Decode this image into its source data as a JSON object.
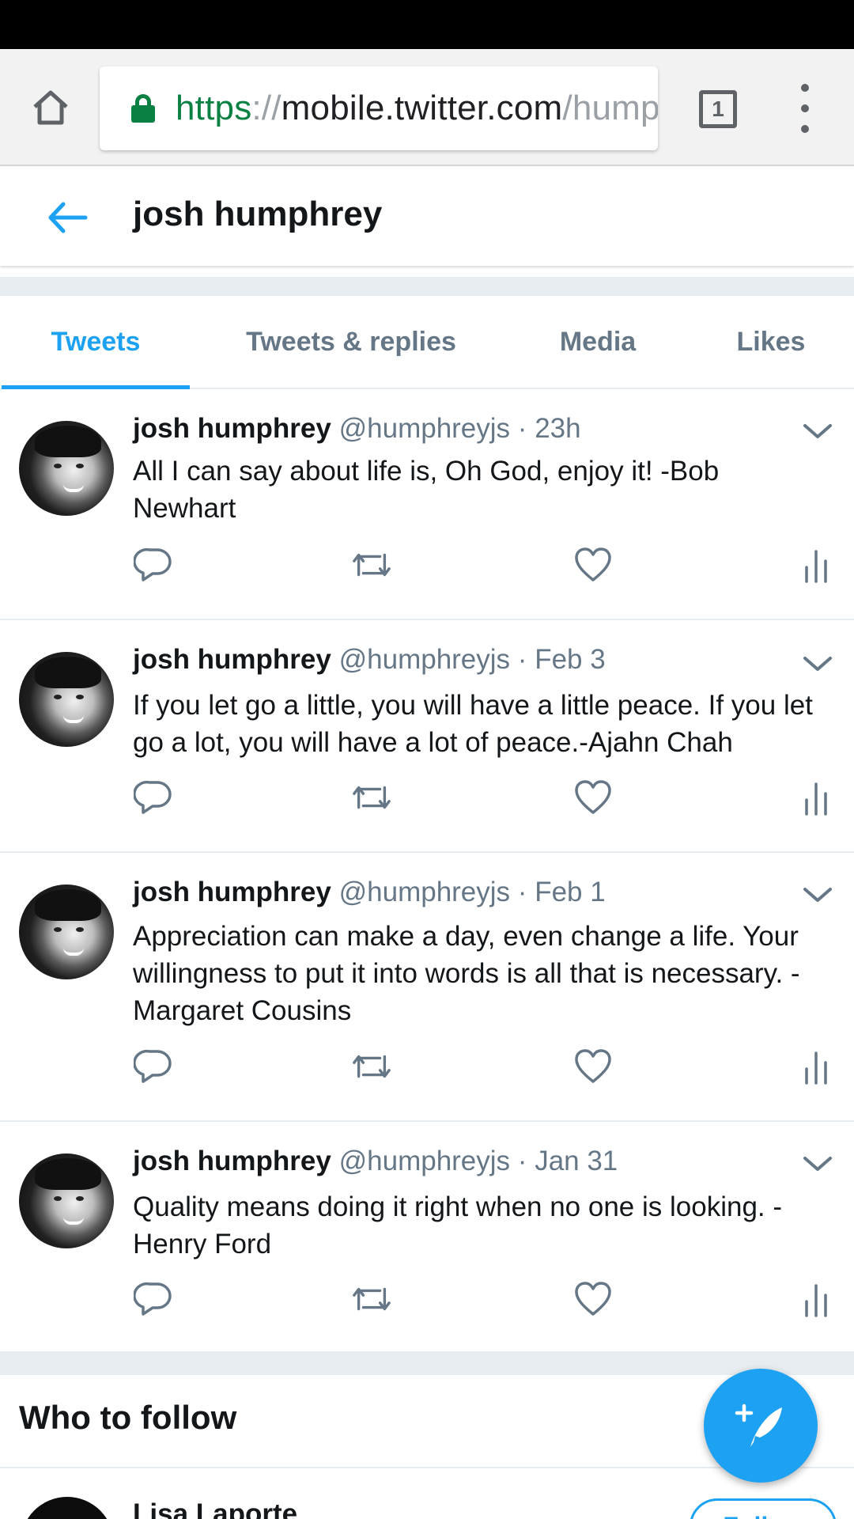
{
  "browser": {
    "url_scheme": "https",
    "url_separator": "://",
    "url_host": "mobile.twitter.com",
    "url_path": "/hump",
    "tab_count": "1",
    "icons": [
      "home-icon",
      "lock-icon",
      "tab-switcher-icon",
      "overflow-menu-icon"
    ],
    "lock_color": "#0b8043"
  },
  "header": {
    "title": "josh humphrey",
    "back_icon": "back-arrow-icon"
  },
  "profile_tabs": [
    {
      "label": "Tweets",
      "active": true
    },
    {
      "label": "Tweets & replies",
      "active": false
    },
    {
      "label": "Media",
      "active": false
    },
    {
      "label": "Likes",
      "active": false
    }
  ],
  "tweets": [
    {
      "name": "josh humphrey",
      "handle": "@humphreyjs",
      "separator": "·",
      "time": "23h",
      "text": "All I can say about life is, Oh God, enjoy it! -Bob Newhart"
    },
    {
      "name": "josh humphrey",
      "handle": "@humphreyjs",
      "separator": "·",
      "time": "Feb 3",
      "text": "If you let go a little, you will have a little peace. If you let go a lot, you will have a lot of peace.-Ajahn Chah"
    },
    {
      "name": "josh humphrey",
      "handle": "@humphreyjs",
      "separator": "·",
      "time": "Feb 1",
      "text": "Appreciation can make a day, even change a life. Your willingness to put it into words is all that is necessary. -Margaret Cousins"
    },
    {
      "name": "josh humphrey",
      "handle": "@humphreyjs",
      "separator": "·",
      "time": "Jan 31",
      "text": "Quality means doing it right when no one is looking. -Henry Ford"
    }
  ],
  "tweet_action_icons": [
    "reply-icon",
    "retweet-icon",
    "like-icon",
    "analytics-icon"
  ],
  "who_to_follow": {
    "title": "Who to follow",
    "suggestions": [
      {
        "name": "Lisa Laporte",
        "button_label": "Follow"
      }
    ]
  },
  "compose_icon": "compose-tweet-icon",
  "colors": {
    "accent": "#1da1f2",
    "text_primary": "#14171a",
    "text_secondary": "#657786",
    "divider": "#e6ecf0"
  }
}
